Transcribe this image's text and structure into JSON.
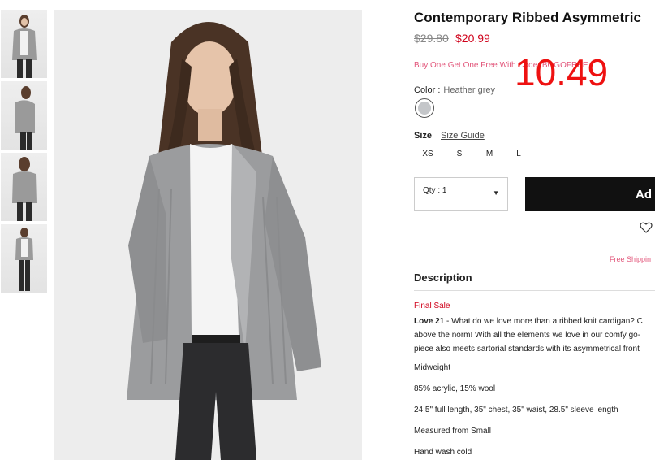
{
  "product": {
    "title": "Contemporary Ribbed Asymmetric",
    "price_old": "$29.80",
    "price_new": "$20.99",
    "promo": "Buy One Get One Free With Code: BOGOFREE",
    "overlay_price": "10.49"
  },
  "color": {
    "label": "Color :",
    "value": "Heather grey",
    "swatch_hex": "#c4c6c9"
  },
  "size": {
    "label": "Size",
    "guide": "Size Guide",
    "options": [
      "XS",
      "S",
      "M",
      "L"
    ]
  },
  "qty": {
    "label": "Qty : 1"
  },
  "cart": {
    "button": "Ad"
  },
  "shipping": {
    "text": "Free Shippin"
  },
  "description": {
    "heading": "Description",
    "final_sale": "Final Sale",
    "brand": "Love 21",
    "intro_1": " - What do we love more than a ribbed knit cardigan? C",
    "intro_2": "above the norm! With all the elements we love in our comfy go-",
    "intro_3": "piece also meets sartorial standards with its asymmetrical front",
    "weight": "Midweight",
    "fabric": "85% acrylic, 15% wool",
    "measure": "24.5\" full length, 35\" chest, 35\" waist, 28.5\" sleeve length",
    "measured_from": "Measured from Small",
    "care": "Hand wash cold"
  },
  "icons": {
    "heart": "heart-icon",
    "caret": "caret-down-icon"
  },
  "colors": {
    "accent_red": "#d0021b",
    "promo_pink": "#e2557a",
    "button_black": "#111111"
  }
}
